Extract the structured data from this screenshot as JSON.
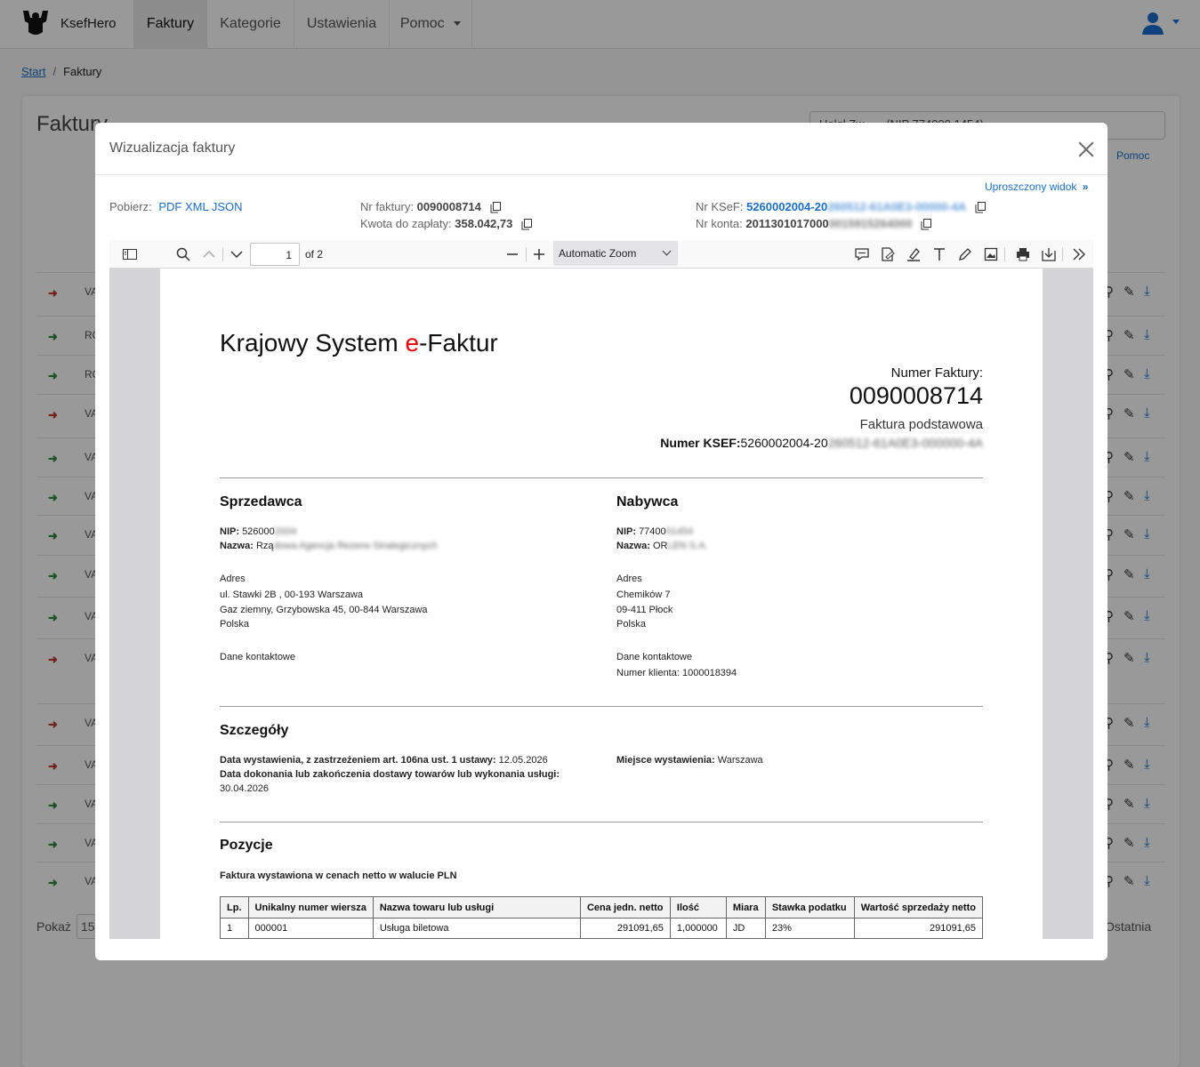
{
  "navbar": {
    "brand": "KsefHero",
    "tabs": [
      "Faktury",
      "Kategorie",
      "Ustawienia",
      "Pomoc"
    ],
    "active_tab": "Faktury",
    "accent_color": "#1a6fcb"
  },
  "breadcrumb": {
    "start": "Start",
    "current": "Faktury"
  },
  "page": {
    "title": "Faktury",
    "company_select": "Holql Zw...... (NIP 774000 1454)",
    "help": "Pomoc",
    "rows": [
      {
        "dir": "in",
        "prefix": "VA"
      },
      {
        "dir": "out",
        "prefix": "RO"
      },
      {
        "dir": "out",
        "prefix": "RO"
      },
      {
        "dir": "in",
        "prefix": "VA"
      },
      {
        "dir": "out",
        "prefix": "VA"
      },
      {
        "dir": "out",
        "prefix": "VA"
      },
      {
        "dir": "out",
        "prefix": "VA"
      },
      {
        "dir": "out",
        "prefix": "VA"
      },
      {
        "dir": "out",
        "prefix": "VA"
      },
      {
        "dir": "in",
        "prefix": "VA"
      },
      {
        "dir": "in",
        "prefix": "VA"
      },
      {
        "dir": "in",
        "prefix": "VA"
      },
      {
        "dir": "out",
        "prefix": "VA"
      },
      {
        "dir": "out",
        "prefix": "VA"
      },
      {
        "dir": "out",
        "prefix": "VA"
      }
    ],
    "show_label": "Pokaż",
    "show_value": "15",
    "last_label": "Ostatnia"
  },
  "modal": {
    "title": "Wizualizacja faktury",
    "simplified_view": "Uproszczony widok",
    "download_label": "Pobierz:",
    "download_links": [
      "PDF",
      "XML",
      "JSON"
    ],
    "invoice_no_label": "Nr faktury:",
    "invoice_no": "0090008714",
    "amount_label": "Kwota do zapłaty:",
    "amount": "358.042,73",
    "ksef_label": "Nr KSeF:",
    "ksef_visible": "5260002004-20",
    "ksef_hidden": "260512-61A0E3-00000-4A",
    "account_label": "Nr konta:",
    "account_visible": "2011301017000",
    "account_hidden": "0015915264000"
  },
  "pdf_viewer": {
    "page_number": "1",
    "page_of": "of 2",
    "zoom": "Automatic Zoom"
  },
  "invoice_doc": {
    "logo_prefix": "Krajowy System ",
    "logo_e": "e",
    "logo_suffix": "-Faktur",
    "number_label": "Numer Faktury:",
    "number": "0090008714",
    "type": "Faktura podstawowa",
    "ksef_label": "Numer KSEF:",
    "ksef_visible": "5260002004-20",
    "ksef_hidden": "260512-61A0E3-000000-4A",
    "seller": {
      "heading": "Sprzedawca",
      "nip_label": "NIP:",
      "nip_visible": "526000",
      "nip_hidden": "2004",
      "name_label": "Nazwa:",
      "name_visible": "Rzą",
      "name_hidden": "dowa Agencja Rezerw Strategicznych",
      "address_heading": "Adres",
      "address": [
        "ul. Stawki 2B , 00-193 Warszawa",
        "Gaz ziemny, Grzybowska 45, 00-844 Warszawa",
        "Polska"
      ],
      "contact_heading": "Dane kontaktowe"
    },
    "buyer": {
      "heading": "Nabywca",
      "nip_label": "NIP:",
      "nip_visible": "77400",
      "nip_hidden": "01454",
      "name_label": "Nazwa:",
      "name_visible": "OR",
      "name_hidden": "LEN S.A.",
      "address_heading": "Adres",
      "address": [
        "Chemików 7",
        "09-411 Płock",
        "Polska"
      ],
      "contact_heading": "Dane kontaktowe",
      "client_no_label": "Numer klienta:",
      "client_no": "1000018394"
    },
    "details": {
      "heading": "Szczegóły",
      "issue_label": "Data wystawienia, z zastrzeżeniem art. 106na ust. 1 ustawy:",
      "issue_date": "12.05.2026",
      "delivery_label": "Data dokonania lub zakończenia dostawy towarów lub wykonania usługi:",
      "delivery_date": "30.04.2026",
      "place_label": "Miejsce wystawienia:",
      "place": "Warszawa"
    },
    "positions": {
      "heading": "Pozycje",
      "note": "Faktura wystawiona w cenach netto w walucie PLN",
      "columns": [
        "Lp.",
        "Unikalny numer wiersza",
        "Nazwa towaru lub usługi",
        "Cena jedn. netto",
        "Ilość",
        "Miara",
        "Stawka podatku",
        "Wartość sprzedaży netto"
      ],
      "rows": [
        [
          "1",
          "000001",
          "Usługa biletowa",
          "291091,65",
          "1,000000",
          "JD",
          "23%",
          "291091,65"
        ]
      ]
    }
  }
}
